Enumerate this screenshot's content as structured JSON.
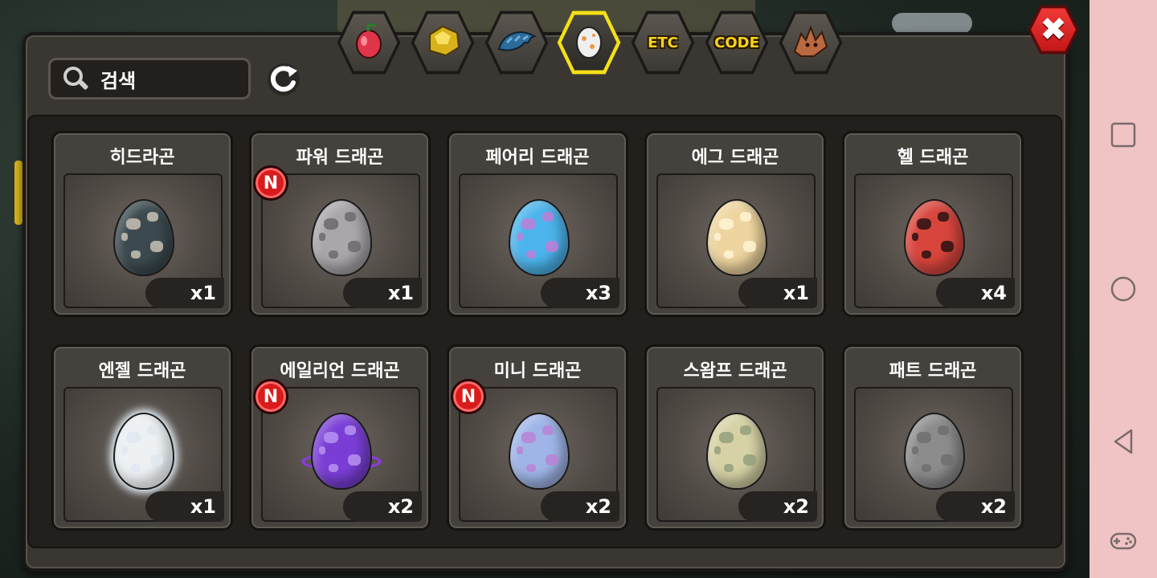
{
  "search": {
    "placeholder": "검색"
  },
  "tabs": [
    {
      "name": "fruit",
      "label": "",
      "icon": "red-fruit-icon",
      "active": false
    },
    {
      "name": "gold",
      "label": "",
      "icon": "gold-ore-icon",
      "active": false
    },
    {
      "name": "dragon-food",
      "label": "",
      "icon": "blue-dragon-icon",
      "active": false
    },
    {
      "name": "eggs",
      "label": "",
      "icon": "egg-icon",
      "active": true
    },
    {
      "name": "etc",
      "label": "ETC",
      "icon": "",
      "active": false
    },
    {
      "name": "code",
      "label": "CODE",
      "icon": "",
      "active": false
    },
    {
      "name": "dragon",
      "label": "",
      "icon": "dragon-head-icon",
      "active": false
    }
  ],
  "items": [
    {
      "name": "히드라곤",
      "count": "x1",
      "is_new": false,
      "egg_color": "#3c4a4f",
      "spot_color": "#c9c2b5"
    },
    {
      "name": "파워 드래곤",
      "count": "x1",
      "is_new": true,
      "egg_color": "#aaa6ab",
      "spot_color": "#6d6a6f"
    },
    {
      "name": "페어리 드래곤",
      "count": "x3",
      "is_new": false,
      "egg_color": "#4cb4ec",
      "spot_color": "#c07ed6"
    },
    {
      "name": "에그 드래곤",
      "count": "x1",
      "is_new": false,
      "egg_color": "#eed5a0",
      "spot_color": "#fff4d4"
    },
    {
      "name": "헬 드래곤",
      "count": "x4",
      "is_new": false,
      "egg_color": "#d8453c",
      "spot_color": "#2a1212"
    },
    {
      "name": "엔젤 드래곤",
      "count": "x1",
      "is_new": false,
      "egg_color": "#edf1f4",
      "spot_color": "#dfe8ee"
    },
    {
      "name": "에일리언 드래곤",
      "count": "x2",
      "is_new": true,
      "egg_color": "#7a3ed6",
      "spot_color": "#b792f0"
    },
    {
      "name": "미니 드래곤",
      "count": "x2",
      "is_new": true,
      "egg_color": "#9fb5e8",
      "spot_color": "#b884d6"
    },
    {
      "name": "스왐프 드래곤",
      "count": "x2",
      "is_new": false,
      "egg_color": "#d6d2a6",
      "spot_color": "#93a07d"
    },
    {
      "name": "패트 드래곤",
      "count": "x2",
      "is_new": false,
      "egg_color": "#8c8c8c",
      "spot_color": "#6f6f6f"
    }
  ],
  "badge_label": "N",
  "close_label": "✖",
  "colors": {
    "active_tab": "#f5e017",
    "new_badge": "#d91b1b",
    "close": "#e32626"
  },
  "navbar": {
    "buttons": [
      "recent-apps-icon",
      "home-icon",
      "back-icon",
      "game-controller-icon"
    ]
  }
}
